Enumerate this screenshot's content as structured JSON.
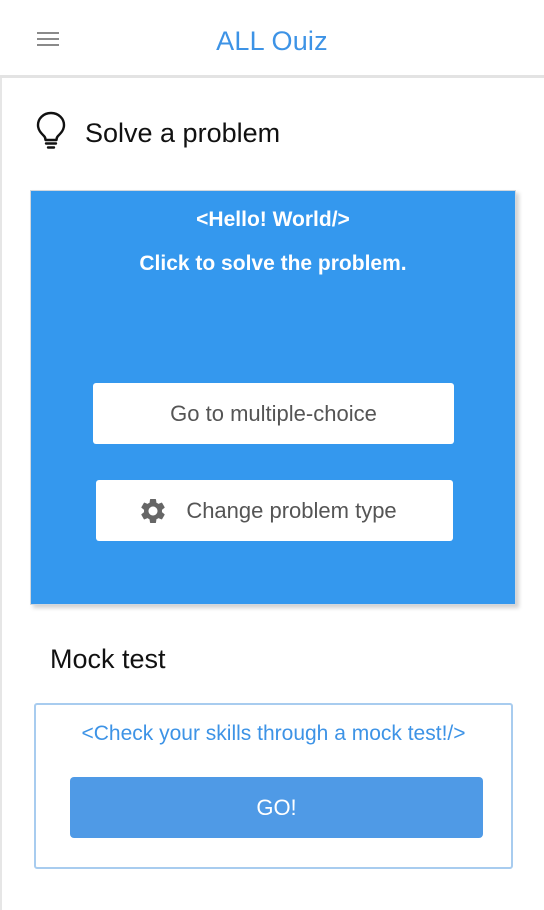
{
  "header": {
    "title": "ALL Ouiz",
    "menu_icon": "hamburger-menu-icon"
  },
  "solve_section": {
    "icon": "lightbulb-icon",
    "title": "Solve a problem",
    "card": {
      "heading": "<Hello! World/>",
      "subtitle": "Click to solve the  problem.",
      "primary_button": "Go to multiple-choice",
      "secondary_button": "Change problem type",
      "secondary_icon": "gear-icon",
      "background_color": "#3498ee"
    }
  },
  "mock_section": {
    "title": "Mock test",
    "subtitle": "<Check your skills through a mock test!/>",
    "button": "GO!",
    "accent_color": "#3d93e6"
  }
}
